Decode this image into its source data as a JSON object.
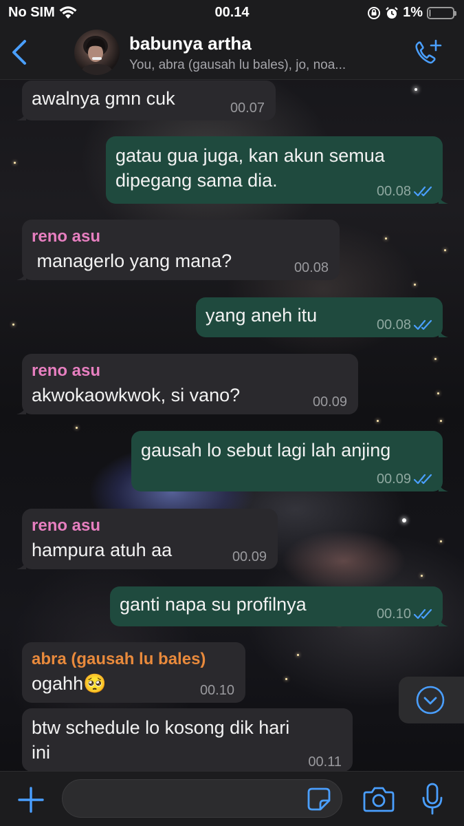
{
  "status_bar": {
    "carrier": "No SIM",
    "time": "00.14",
    "battery_percent": "1%",
    "battery_level": 0.01
  },
  "header": {
    "group_name": "babunya artha",
    "members": "You, abra (gausah lu bales), jo, noa..."
  },
  "messages": [
    {
      "direction": "in",
      "sender": "",
      "text": "awalnya gmn cuk",
      "time": "00.07"
    },
    {
      "direction": "out",
      "text_lines": [
        "gatau gua juga, kan akun semua",
        "dipegang sama dia."
      ],
      "time": "00.08"
    },
    {
      "direction": "in",
      "sender": "reno asu",
      "text": " managerlo yang mana?",
      "time": "00.08"
    },
    {
      "direction": "out",
      "text": "yang aneh itu",
      "time": "00.08"
    },
    {
      "direction": "in",
      "sender": "reno asu",
      "text": "akwokaowkwok, si vano?",
      "time": "00.09"
    },
    {
      "direction": "out",
      "text": "gausah lo sebut lagi lah anjing",
      "time": "00.09"
    },
    {
      "direction": "in",
      "sender": "reno asu",
      "text": "hampura atuh aa",
      "time": "00.09"
    },
    {
      "direction": "out",
      "text": "ganti napa su profilnya",
      "time": "00.10"
    },
    {
      "direction": "in",
      "sender": "abra (gausah lu bales)",
      "text": "ogahh🥺",
      "time": "00.10"
    },
    {
      "direction": "in",
      "sender": "",
      "text_lines": [
        "btw schedule lo kosong dik hari",
        "ini"
      ],
      "time": "00.11"
    }
  ],
  "colors": {
    "accent": "#4a9fff",
    "outgoing_bubble": "#1f4a3e",
    "incoming_bubble": "#2a292d",
    "sender_pink": "#e77fc0",
    "sender_orange": "#e98a3c"
  },
  "icons": {
    "back": "chevron-left-icon",
    "add_call": "phone-plus-icon",
    "scroll_down": "chevron-down-circle-icon",
    "plus": "plus-icon",
    "sticker": "sticker-icon",
    "camera": "camera-icon",
    "mic": "microphone-icon"
  }
}
